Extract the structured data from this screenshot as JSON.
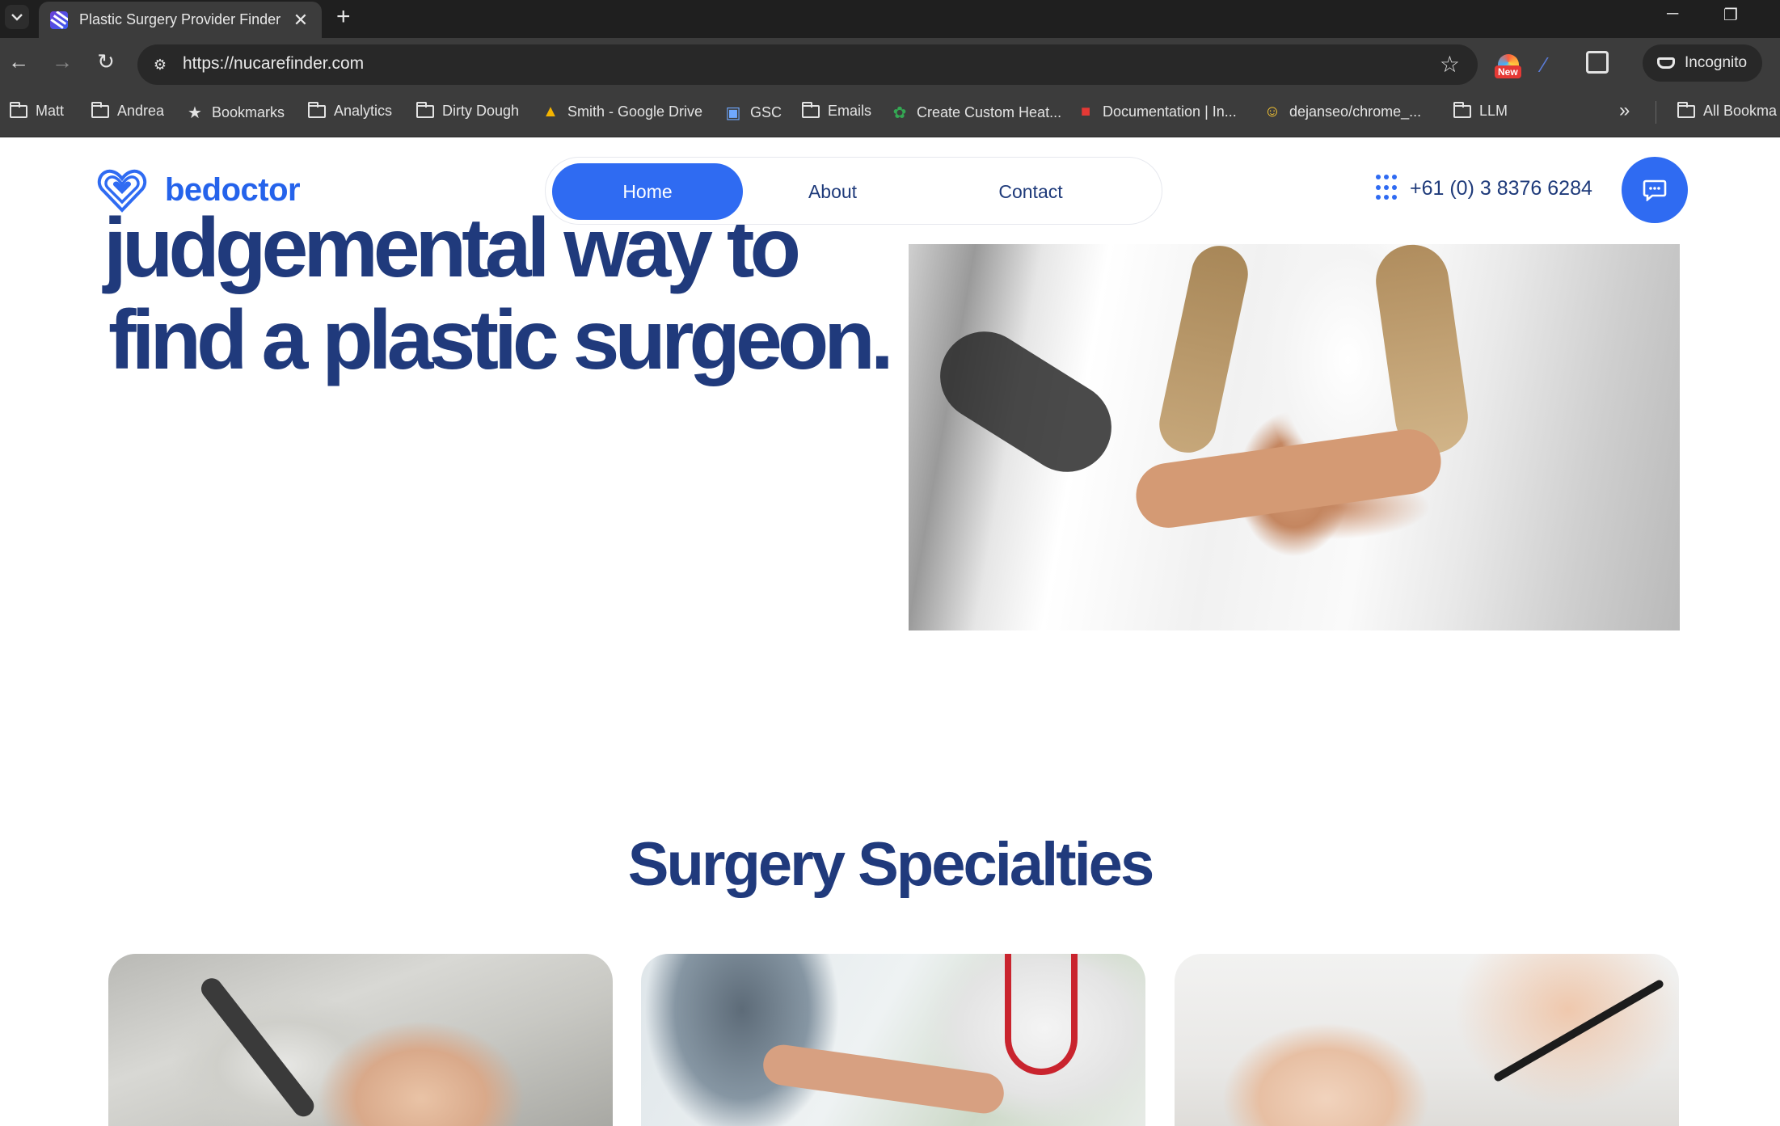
{
  "browser": {
    "tab_title": "Plastic Surgery Provider Finder",
    "url": "https://nucarefinder.com",
    "incognito_label": "Incognito",
    "new_badge": "New",
    "bookmarks": [
      {
        "label": "Matt",
        "icon": "folder-icon"
      },
      {
        "label": "Andrea",
        "icon": "folder-icon"
      },
      {
        "label": "Bookmarks",
        "icon": "star-icon"
      },
      {
        "label": "Analytics",
        "icon": "folder-icon"
      },
      {
        "label": "Dirty Dough",
        "icon": "folder-icon"
      },
      {
        "label": "Smith - Google Drive",
        "icon": "google-drive-icon"
      },
      {
        "label": "GSC",
        "icon": "gsc-icon"
      },
      {
        "label": "Emails",
        "icon": "folder-icon"
      },
      {
        "label": "Create Custom Heat...",
        "icon": "heatmap-site-icon"
      },
      {
        "label": "Documentation | In...",
        "icon": "documentation-site-icon"
      },
      {
        "label": "dejanseo/chrome_...",
        "icon": "hugging-face-icon"
      },
      {
        "label": "LLM",
        "icon": "folder-icon"
      },
      {
        "label": "All Bookma",
        "icon": "folder-icon"
      }
    ]
  },
  "header": {
    "brand": "bedoctor",
    "nav": [
      "Home",
      "About",
      "Contact"
    ],
    "active_nav": "Home",
    "phone": "+61 (0) 3 8376 6284",
    "accent_color": "#2f6bf2",
    "heading_color": "#203a7c"
  },
  "hero": {
    "heading_line1": "judgemental way to",
    "heading_line2": "find a plastic surgeon."
  },
  "specialties": {
    "title": "Surgery Specialties"
  }
}
